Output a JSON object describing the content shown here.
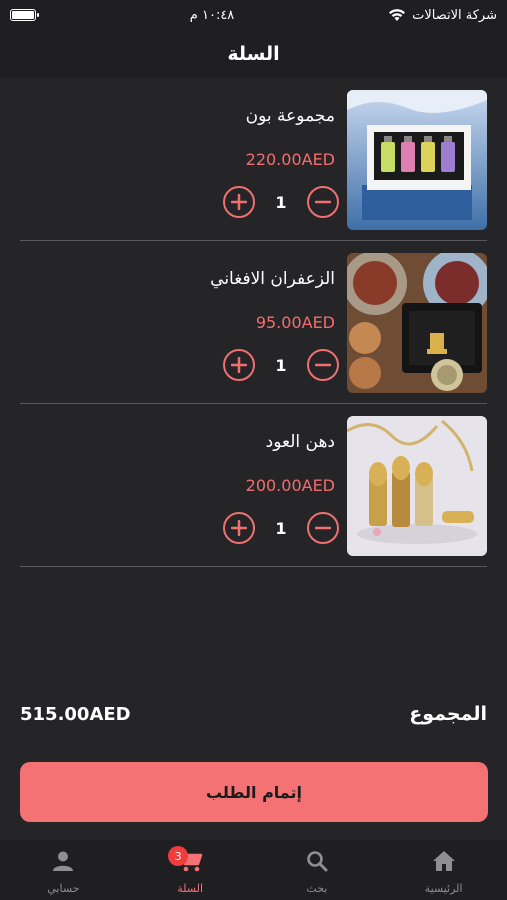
{
  "status": {
    "carrier": "شركة الاتصالات",
    "time": "١٠:٤٨ م",
    "battery_level": 1.0
  },
  "header": {
    "title": "السلة"
  },
  "cart": {
    "items": [
      {
        "name": "مجموعة بون",
        "price": "220.00AED",
        "quantity": "1",
        "image": "perfume-gift-box"
      },
      {
        "name": "الزعفران الافغاني",
        "price": "95.00AED",
        "quantity": "1",
        "image": "saffron-tins"
      },
      {
        "name": "دهن العود",
        "price": "200.00AED",
        "quantity": "1",
        "image": "oud-oil-bottles"
      }
    ]
  },
  "summary": {
    "total_label": "المجموع",
    "total_value": "515.00AED"
  },
  "checkout": {
    "label": "إتمام الطلب"
  },
  "tabs": [
    {
      "label": "حسابي",
      "icon": "person-icon"
    },
    {
      "label": "السلة",
      "icon": "cart-icon",
      "badge": "3",
      "active": true
    },
    {
      "label": "بحث",
      "icon": "search-icon"
    },
    {
      "label": "الرئيسية",
      "icon": "home-icon"
    }
  ],
  "colors": {
    "accent": "#f47174",
    "background": "#252528",
    "bar": "#1f1f22",
    "price": "#f26d6d",
    "badge": "#f03c3c"
  }
}
